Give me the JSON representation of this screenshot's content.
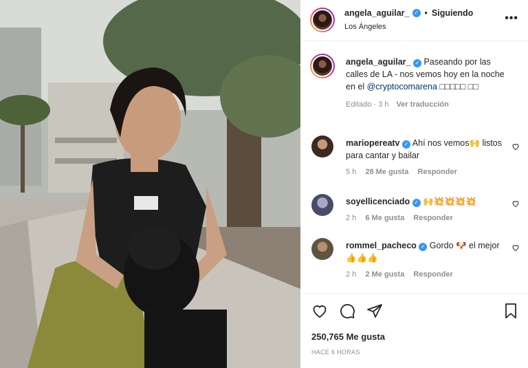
{
  "post": {
    "username": "angela_aguilar_",
    "verified": true,
    "follow_state": "Siguiendo",
    "separator": "•",
    "location": "Los Ángeles",
    "more_icon": "more-options-icon"
  },
  "caption": {
    "username": "angela_aguilar_",
    "text_before": " Paseando por las calles de LA - nos vemos hoy en la noche en el ",
    "mention": "@cryptocomarena",
    "text_after": " □□□□□ □□",
    "edited": "Editado · 3 h",
    "translate": "Ver traducción"
  },
  "comments": [
    {
      "username": "mariopereatv",
      "verified": true,
      "text": " Ahí nos vemos🙌 listos para cantar y bailar",
      "time": "5 h",
      "likes": "28 Me gusta",
      "reply": "Responder"
    },
    {
      "username": "soyellicenciado",
      "verified": true,
      "text": " 🙌💥💥💥💥",
      "time": "2 h",
      "likes": "6 Me gusta",
      "reply": "Responder"
    },
    {
      "username": "rommel_pacheco",
      "verified": true,
      "text": " Gordo 🐶 el mejor 👍👍👍",
      "time": "2 h",
      "likes": "2 Me gusta",
      "reply": "Responder"
    }
  ],
  "actions": {
    "likes": "250,765 Me gusta",
    "posted": "HACE 6 HORAS",
    "icons": [
      "heart-icon",
      "comment-icon",
      "share-icon",
      "save-icon"
    ]
  },
  "colors": {
    "verified": "#3897f0",
    "mention": "#00376b",
    "muted": "#8e8e8e",
    "text": "#262626"
  }
}
